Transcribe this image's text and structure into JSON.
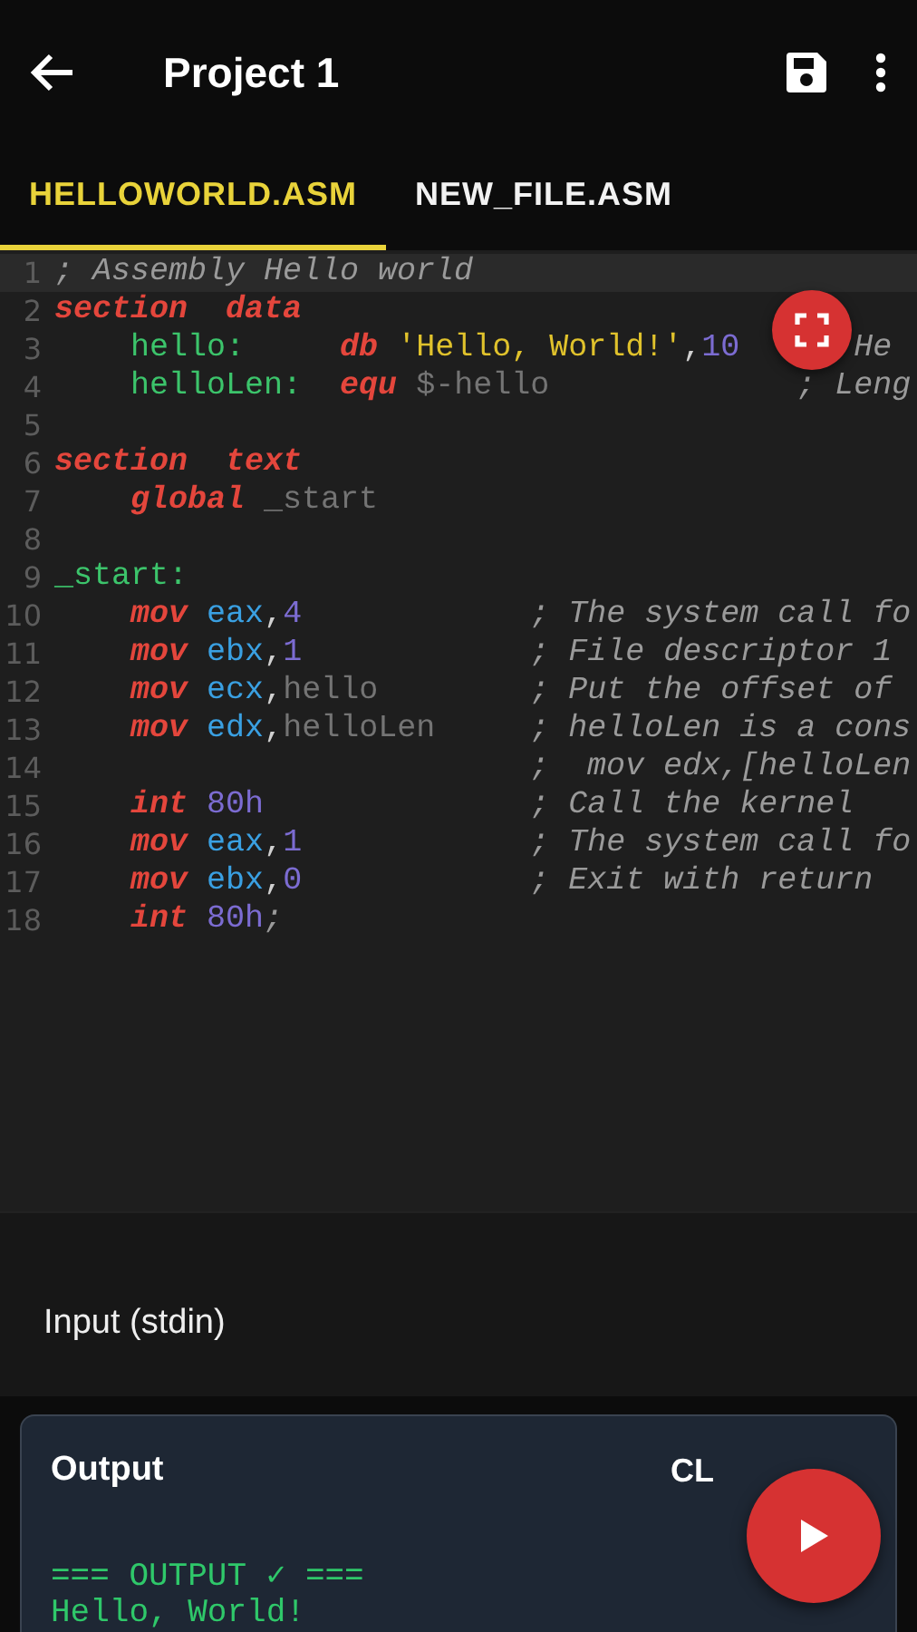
{
  "app_bar": {
    "title": "Project 1"
  },
  "tabs": [
    {
      "label": "HELLOWORLD.ASM",
      "selected": true
    },
    {
      "label": "NEW_FILE.ASM",
      "selected": false
    }
  ],
  "editor": {
    "lines": [
      {
        "number": "1",
        "tokens": [
          {
            "text": "; Assembly Hello world",
            "kind": "comment"
          }
        ]
      },
      {
        "number": "2",
        "tokens": [
          {
            "text": "section",
            "kind": "keyword"
          },
          {
            "text": "  data",
            "kind": "keyword"
          }
        ]
      },
      {
        "number": "3",
        "tokens": [
          {
            "text": "    hello:",
            "kind": "label"
          },
          {
            "text": "     db",
            "kind": "keyword"
          },
          {
            "text": " 'Hello, World!'",
            "kind": "string"
          },
          {
            "text": ",",
            "kind": "punct"
          },
          {
            "text": "10",
            "kind": "number"
          },
          {
            "text": "      He",
            "kind": "comment"
          }
        ]
      },
      {
        "number": "4",
        "tokens": [
          {
            "text": "    helloLen:",
            "kind": "label"
          },
          {
            "text": "  equ",
            "kind": "keyword"
          },
          {
            "text": " $-hello",
            "kind": "dim"
          },
          {
            "text": "             ; Leng",
            "kind": "comment"
          }
        ]
      },
      {
        "number": "5"
      },
      {
        "number": "6",
        "tokens": [
          {
            "text": "section",
            "kind": "keyword"
          },
          {
            "text": "  text",
            "kind": "keyword"
          }
        ]
      },
      {
        "number": "7",
        "tokens": [
          {
            "text": "    global",
            "kind": "keyword"
          },
          {
            "text": " _start",
            "kind": "dim"
          }
        ]
      },
      {
        "number": "8"
      },
      {
        "number": "9",
        "tokens": [
          {
            "text": "_start:",
            "kind": "label"
          }
        ]
      },
      {
        "number": "10",
        "tokens": [
          {
            "text": "    mov",
            "kind": "keyword"
          },
          {
            "text": " eax",
            "kind": "register"
          },
          {
            "text": ",",
            "kind": "punct"
          },
          {
            "text": "4",
            "kind": "number"
          },
          {
            "text": "            ; The system call fo",
            "kind": "comment"
          }
        ]
      },
      {
        "number": "11",
        "tokens": [
          {
            "text": "    mov",
            "kind": "keyword"
          },
          {
            "text": " ebx",
            "kind": "register"
          },
          {
            "text": ",",
            "kind": "punct"
          },
          {
            "text": "1",
            "kind": "number"
          },
          {
            "text": "            ; File descriptor 1",
            "kind": "comment"
          }
        ]
      },
      {
        "number": "12",
        "tokens": [
          {
            "text": "    mov",
            "kind": "keyword"
          },
          {
            "text": " ecx",
            "kind": "register"
          },
          {
            "text": ",",
            "kind": "punct"
          },
          {
            "text": "hello",
            "kind": "dim"
          },
          {
            "text": "        ; Put the offset of",
            "kind": "comment"
          }
        ]
      },
      {
        "number": "13",
        "tokens": [
          {
            "text": "    mov",
            "kind": "keyword"
          },
          {
            "text": " edx",
            "kind": "register"
          },
          {
            "text": ",",
            "kind": "punct"
          },
          {
            "text": "helloLen",
            "kind": "dim"
          },
          {
            "text": "     ; helloLen is a cons",
            "kind": "comment"
          }
        ]
      },
      {
        "number": "14",
        "tokens": [
          {
            "text": "                         ;  mov edx,[helloLen",
            "kind": "comment"
          }
        ]
      },
      {
        "number": "15",
        "tokens": [
          {
            "text": "    int",
            "kind": "keyword"
          },
          {
            "text": " 80h",
            "kind": "number"
          },
          {
            "text": "              ; Call the kernel",
            "kind": "comment"
          }
        ]
      },
      {
        "number": "16",
        "tokens": [
          {
            "text": "    mov",
            "kind": "keyword"
          },
          {
            "text": " eax",
            "kind": "register"
          },
          {
            "text": ",",
            "kind": "punct"
          },
          {
            "text": "1",
            "kind": "number"
          },
          {
            "text": "            ; The system call fo",
            "kind": "comment"
          }
        ]
      },
      {
        "number": "17",
        "tokens": [
          {
            "text": "    mov",
            "kind": "keyword"
          },
          {
            "text": " ebx",
            "kind": "register"
          },
          {
            "text": ",",
            "kind": "punct"
          },
          {
            "text": "0",
            "kind": "number"
          },
          {
            "text": "            ; Exit with return",
            "kind": "comment"
          }
        ]
      },
      {
        "number": "18",
        "tokens": [
          {
            "text": "    int",
            "kind": "keyword"
          },
          {
            "text": " 80h",
            "kind": "number"
          },
          {
            "text": ";",
            "kind": "comment"
          }
        ]
      }
    ]
  },
  "input": {
    "label": "Input (stdin)"
  },
  "output": {
    "title": "Output",
    "clear_button": "CL",
    "lines": [
      {
        "text": "=== OUTPUT ✓ ==="
      },
      {
        "text": "Hello, World!"
      }
    ]
  }
}
